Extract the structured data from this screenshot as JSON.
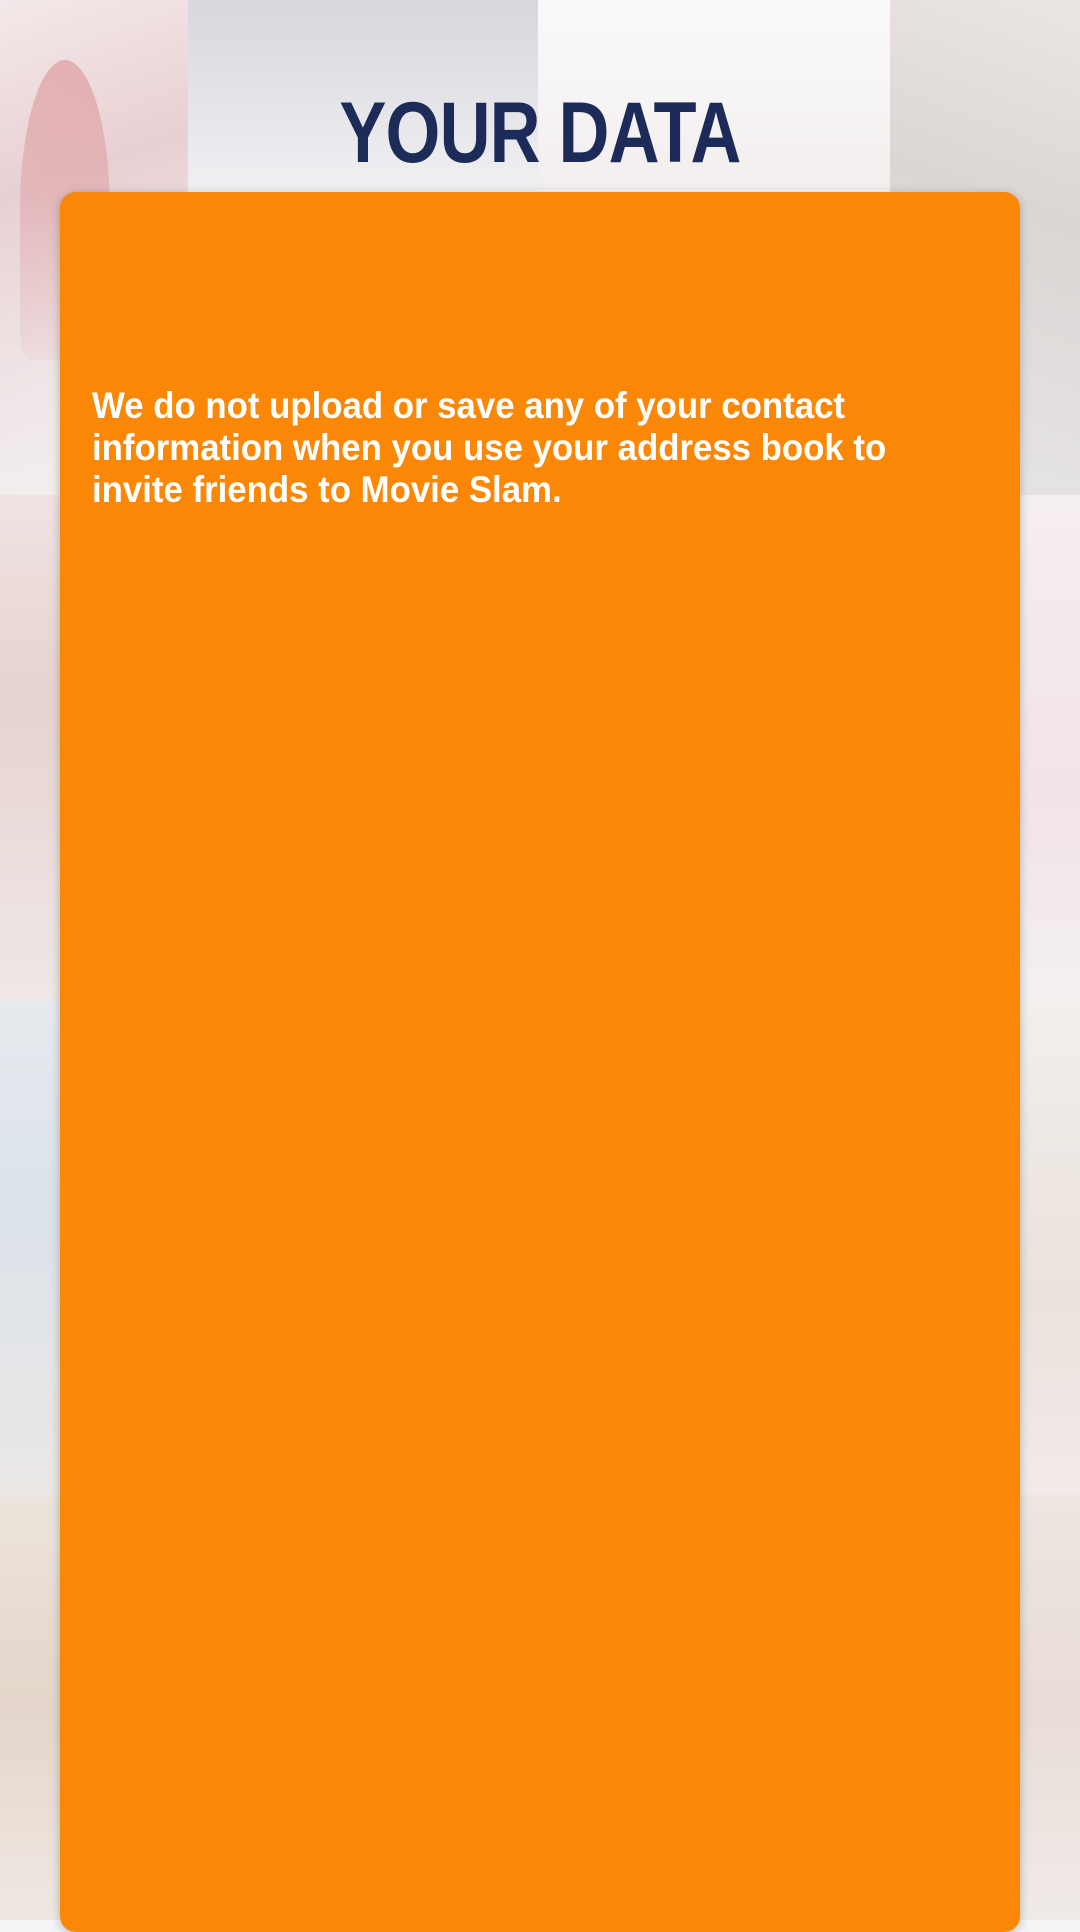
{
  "header": {
    "title": "YOUR DATA"
  },
  "panel": {
    "message": "We do not upload or save any of your contact information when you use your address book to invite friends to Movie Slam."
  },
  "colors": {
    "panel_background": "#fb8706",
    "title_color": "#1c2b57",
    "message_color": "#ffffff"
  }
}
